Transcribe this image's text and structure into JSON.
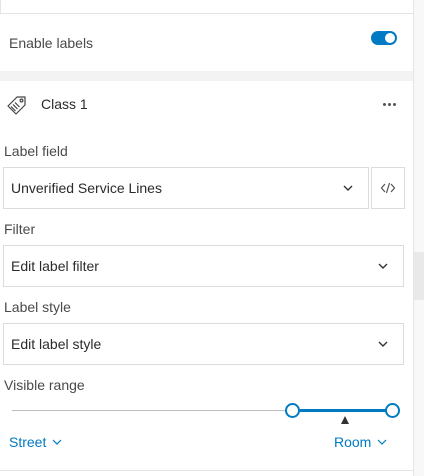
{
  "enable_labels": {
    "label": "Enable labels",
    "enabled": true
  },
  "class_item": {
    "title": "Class 1",
    "icon": "label-class-icon",
    "more_icon": "more-horizontal-icon"
  },
  "label_field": {
    "label": "Label field",
    "value": "Unverified Service Lines",
    "expression_icon": "code-icon"
  },
  "filter": {
    "label": "Filter",
    "value": "Edit label filter"
  },
  "label_style": {
    "label": "Label style",
    "value": "Edit label style"
  },
  "visible_range": {
    "label": "Visible range",
    "min_label": "Street",
    "max_label": "Room",
    "current_position": 0.92
  },
  "colors": {
    "accent": "#007ac2",
    "text": "#323232",
    "border": "#dcdcdc"
  }
}
